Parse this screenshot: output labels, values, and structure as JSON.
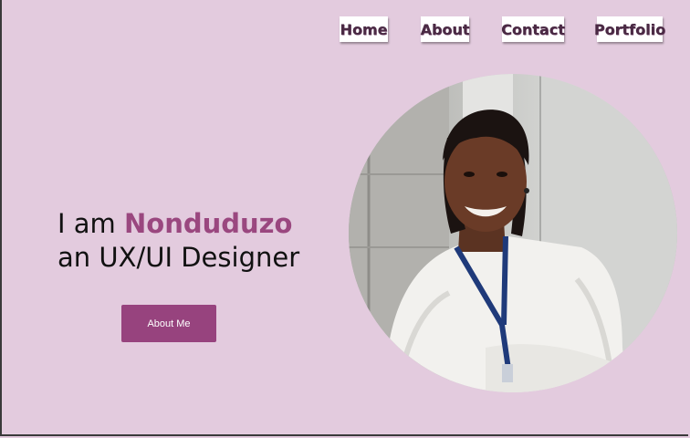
{
  "nav": {
    "home": "Home",
    "about": "About",
    "contact": "Contact",
    "portfolio": "Portfolio"
  },
  "hero": {
    "intro": "I am ",
    "name": "Nonduduzo",
    "role": "an UX/UI Designer",
    "cta": "About Me"
  },
  "colors": {
    "background": "#e3cbde",
    "accent": "#97437e",
    "name": "#9a477f"
  }
}
